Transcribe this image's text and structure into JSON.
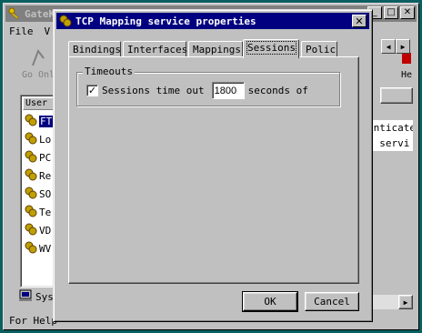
{
  "main_window": {
    "title": "GateK",
    "menu": [
      "File",
      "V"
    ],
    "toolbar_left_label": "Go Onl",
    "toolbar_right_label": "He",
    "left_header": "User S",
    "tree_items": [
      {
        "label": "FT",
        "selected": true
      },
      {
        "label": "Lo",
        "selected": false
      },
      {
        "label": "PC",
        "selected": false
      },
      {
        "label": "Re",
        "selected": false
      },
      {
        "label": "SO",
        "selected": false
      },
      {
        "label": "Te",
        "selected": false
      },
      {
        "label": "VD",
        "selected": false
      },
      {
        "label": "WV",
        "selected": false
      }
    ],
    "left_tab_label": "Sys",
    "right_text_lines": [
      "enticate",
      "e servi"
    ],
    "status_text": "For Help"
  },
  "dialog": {
    "title": "TCP Mapping service properties",
    "tabs": [
      {
        "label": "Bindings",
        "active": false
      },
      {
        "label": "Interfaces",
        "active": false
      },
      {
        "label": "Mappings",
        "active": false
      },
      {
        "label": "Sessions",
        "active": true
      },
      {
        "label": "Polic",
        "active": false
      }
    ],
    "group_title": "Timeouts",
    "sessions_checkbox_label": "Sessions time out",
    "sessions_checked": true,
    "timeout_value": "1800",
    "timeout_suffix": "seconds of",
    "ok_label": "OK",
    "cancel_label": "Cancel"
  },
  "colors": {
    "desktop": "#0b5f5f",
    "active_title": "#000080",
    "inactive_title": "#808080",
    "face": "#c0c0c0"
  }
}
